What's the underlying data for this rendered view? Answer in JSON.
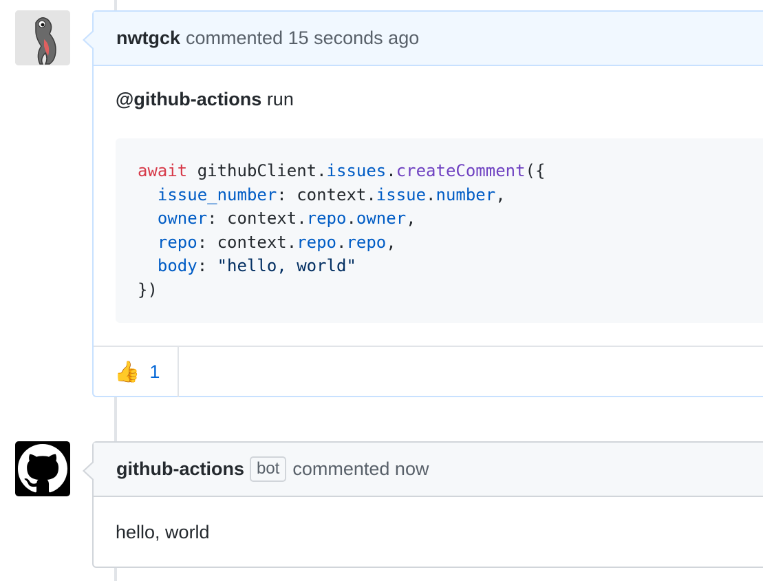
{
  "comments": [
    {
      "author": "nwtgck",
      "meta": "commented 15 seconds ago",
      "mention": "@github-actions",
      "mention_rest": " run",
      "code": {
        "l1_kw": "await",
        "l1_a": " githubClient.",
        "l1_prop": "issues",
        "l1_dot": ".",
        "l1_fn": "createComment",
        "l1_end": "({",
        "l2_prop": "issue_number",
        "l2_a": ": context.",
        "l2_p2": "issue",
        "l2_dot": ".",
        "l2_p3": "number",
        "l2_end": ",",
        "l3_prop": "owner",
        "l3_a": ": context.",
        "l3_p2": "repo",
        "l3_dot": ".",
        "l3_p3": "owner",
        "l3_end": ",",
        "l4_prop": "repo",
        "l4_a": ": context.",
        "l4_p2": "repo",
        "l4_dot": ".",
        "l4_p3": "repo",
        "l4_end": ",",
        "l5_prop": "body",
        "l5_a": ": ",
        "l5_str": "\"hello, world\"",
        "l6": "})"
      },
      "reaction": {
        "emoji": "thumbs-up",
        "count": "1"
      },
      "avatar_icon": "salamander-avatar-icon"
    },
    {
      "author": "github-actions",
      "badge": "bot",
      "meta": "commented now",
      "body": "hello, world",
      "avatar_icon": "github-octocat-icon"
    }
  ],
  "colors": {
    "keyword": "#d73a49",
    "property": "#005cc5",
    "function": "#6f42c1",
    "link": "#0366d6",
    "header_bg_highlight": "#f1f8ff"
  }
}
